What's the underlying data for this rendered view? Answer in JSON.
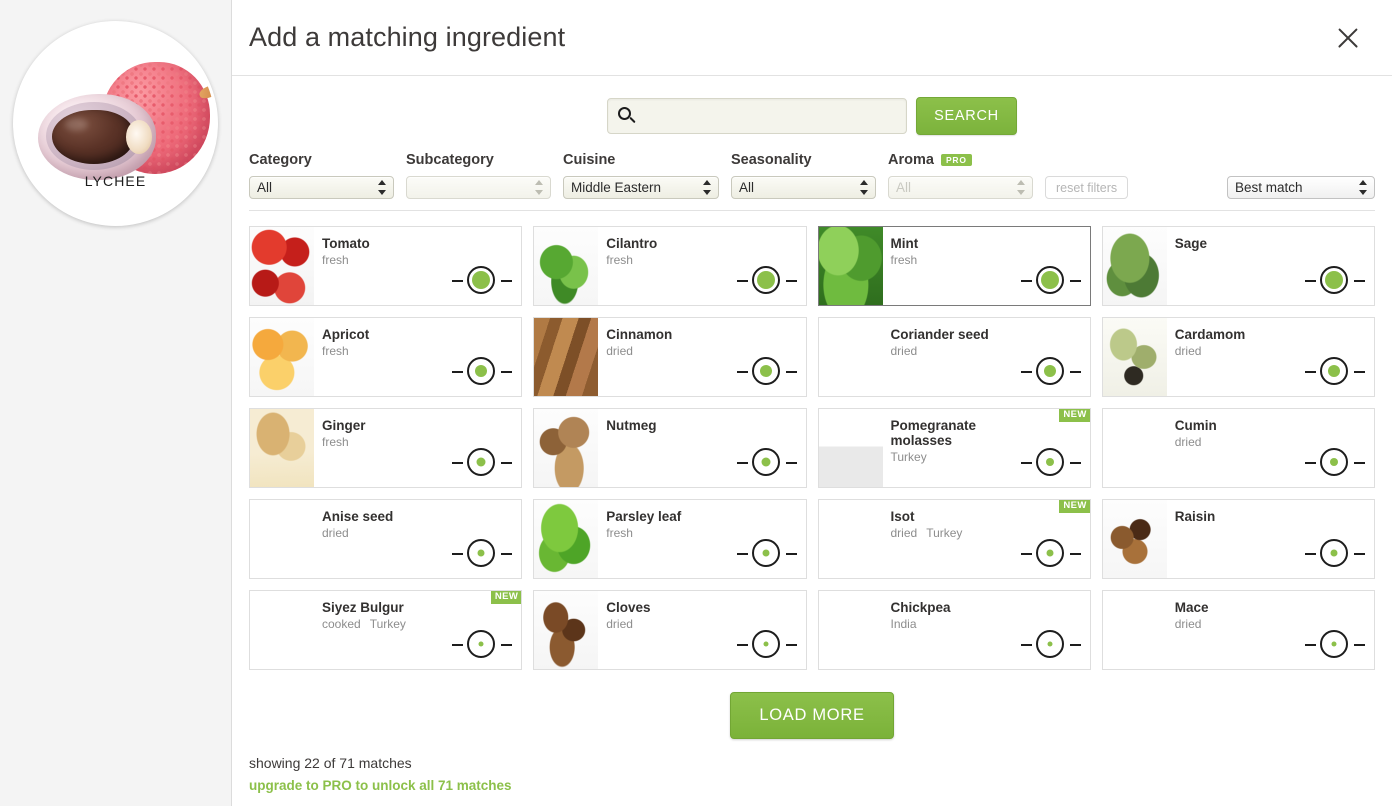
{
  "sidebar": {
    "hero_label": "LYCHEE",
    "hero_image_alt": "lychee"
  },
  "header": {
    "title": "Add a matching ingredient",
    "close_label": "close"
  },
  "search": {
    "value": "",
    "placeholder": "",
    "button_label": "SEARCH"
  },
  "filters": {
    "category": {
      "label": "Category",
      "value": "All"
    },
    "subcategory": {
      "label": "Subcategory",
      "value": ""
    },
    "cuisine": {
      "label": "Cuisine",
      "value": "Middle Eastern"
    },
    "seasonality": {
      "label": "Seasonality",
      "value": "All"
    },
    "aroma": {
      "label": "Aroma",
      "badge": "PRO",
      "value": "All"
    },
    "reset_label": "reset filters",
    "sort": {
      "value": "Best match"
    }
  },
  "colors": {
    "accent_green": "#8cc04a",
    "badge_green": "#8cc04a",
    "text_dark": "#3d3a39",
    "text_muted": "#8d8d8d"
  },
  "results": {
    "cards": [
      {
        "name": "Tomato",
        "subs": [
          "fresh"
        ],
        "match": 18,
        "new": false,
        "highlight": false,
        "img": "tomato"
      },
      {
        "name": "Cilantro",
        "subs": [
          "fresh"
        ],
        "match": 18,
        "new": false,
        "highlight": false,
        "img": "cilantro"
      },
      {
        "name": "Mint",
        "subs": [
          "fresh"
        ],
        "match": 18,
        "new": false,
        "highlight": true,
        "img": "mint"
      },
      {
        "name": "Sage",
        "subs": [],
        "match": 18,
        "new": false,
        "highlight": false,
        "img": "sage"
      },
      {
        "name": "Apricot",
        "subs": [
          "fresh"
        ],
        "match": 12,
        "new": false,
        "highlight": false,
        "img": "apricot"
      },
      {
        "name": "Cinnamon",
        "subs": [
          "dried"
        ],
        "match": 12,
        "new": false,
        "highlight": false,
        "img": "cinnamon"
      },
      {
        "name": "Coriander seed",
        "subs": [
          "dried"
        ],
        "match": 12,
        "new": false,
        "highlight": false,
        "img": "corianderseed"
      },
      {
        "name": "Cardamom",
        "subs": [
          "dried"
        ],
        "match": 12,
        "new": false,
        "highlight": false,
        "img": "cardamom"
      },
      {
        "name": "Ginger",
        "subs": [
          "fresh"
        ],
        "match": 9,
        "new": false,
        "highlight": false,
        "img": "ginger"
      },
      {
        "name": "Nutmeg",
        "subs": [],
        "match": 9,
        "new": false,
        "highlight": false,
        "img": "nutmeg"
      },
      {
        "name": "Pomegranate molasses",
        "subs": [
          "Turkey"
        ],
        "match": 8,
        "new": true,
        "highlight": false,
        "img": "pomegranate"
      },
      {
        "name": "Cumin",
        "subs": [
          "dried"
        ],
        "match": 8,
        "new": false,
        "highlight": false,
        "img": "cumin"
      },
      {
        "name": "Anise seed",
        "subs": [
          "dried"
        ],
        "match": 7,
        "new": false,
        "highlight": false,
        "img": "aniseseed"
      },
      {
        "name": "Parsley leaf",
        "subs": [
          "fresh"
        ],
        "match": 7,
        "new": false,
        "highlight": false,
        "img": "parsley"
      },
      {
        "name": "Isot",
        "subs": [
          "dried",
          "Turkey"
        ],
        "match": 7,
        "new": true,
        "highlight": false,
        "img": "isot"
      },
      {
        "name": "Raisin",
        "subs": [],
        "match": 7,
        "new": false,
        "highlight": false,
        "img": "raisin"
      },
      {
        "name": "Siyez Bulgur",
        "subs": [
          "cooked",
          "Turkey"
        ],
        "match": 5,
        "new": true,
        "highlight": false,
        "img": "bulgur"
      },
      {
        "name": "Cloves",
        "subs": [
          "dried"
        ],
        "match": 5,
        "new": false,
        "highlight": false,
        "img": "cloves"
      },
      {
        "name": "Chickpea",
        "subs": [
          "India"
        ],
        "match": 5,
        "new": false,
        "highlight": false,
        "img": "chickpea"
      },
      {
        "name": "Mace",
        "subs": [
          "dried"
        ],
        "match": 5,
        "new": false,
        "highlight": false,
        "img": "mace"
      }
    ],
    "new_badge_label": "NEW"
  },
  "footer": {
    "load_more_label": "LOAD MORE",
    "status": "showing 22 of 71 matches",
    "upgrade": "upgrade to PRO to unlock all 71 matches"
  }
}
